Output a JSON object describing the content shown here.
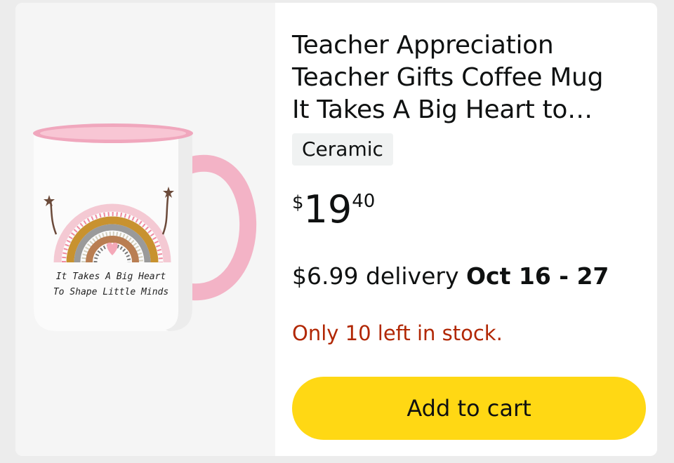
{
  "product": {
    "image_alt": "Pink coffee mug with rainbow and heart",
    "mug_text_line1": "It Takes A Big Heart",
    "mug_text_line2": "To Shape Little Minds",
    "title_line1": "Teacher Appreciation",
    "title_line2": "Teacher Gifts Coffee Mug",
    "title_line3": "It Takes A Big Heart to…",
    "material_badge": "Ceramic",
    "price": {
      "currency": "$",
      "whole": "19",
      "fraction": "40"
    },
    "delivery": {
      "fee": "$6.99 delivery",
      "dates": "Oct 16 - 27"
    },
    "stock_text": "Only 10 left in stock.",
    "add_to_cart_label": "Add to cart"
  },
  "colors": {
    "button_bg": "#ffd814",
    "stock_red": "#b12704",
    "badge_bg": "#f0f2f2",
    "mug_pink": "#f4b6c8"
  }
}
